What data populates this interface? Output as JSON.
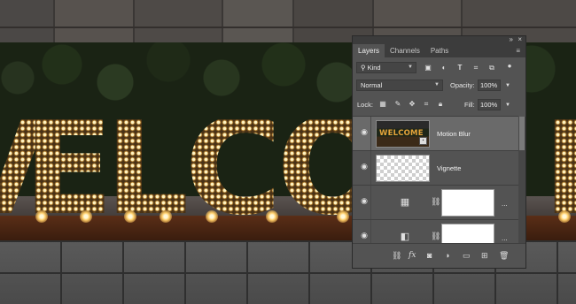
{
  "scene": {
    "letters": [
      "V",
      "E",
      "L",
      "C",
      "O",
      "E"
    ]
  },
  "panel": {
    "collapse_label": "»",
    "close_label": "×",
    "tabs": [
      {
        "label": "Layers",
        "active": true
      },
      {
        "label": "Channels",
        "active": false
      },
      {
        "label": "Paths",
        "active": false
      }
    ],
    "menu_label": "≡",
    "filter": {
      "value": "Kind",
      "icon": "search-icon"
    },
    "filter_icons": [
      "image-filter-icon",
      "adjustment-filter-icon",
      "type-filter-icon",
      "shape-filter-icon",
      "smart-object-filter-icon",
      "filter-toggle-icon"
    ],
    "blend_mode": "Normal",
    "opacity_label": "Opacity:",
    "opacity_value": "100%",
    "lock_label": "Lock:",
    "lock_icons": [
      "lock-transparent-icon",
      "lock-image-icon",
      "lock-position-icon",
      "lock-artboard-icon",
      "lock-all-icon"
    ],
    "fill_label": "Fill:",
    "fill_value": "100%",
    "layers": [
      {
        "name": "Motion Blur",
        "selected": true,
        "thumb_text": "WELCOME",
        "type": "smart-object"
      },
      {
        "name": "Vignette",
        "selected": false,
        "type": "empty"
      },
      {
        "name": "",
        "selected": false,
        "type": "pattern-adjustment",
        "more": "..."
      },
      {
        "name": "",
        "selected": false,
        "type": "gradient-adjustment",
        "more": "..."
      }
    ],
    "bottom_icons": [
      "link-layers-icon",
      "fx-icon",
      "add-mask-icon",
      "adjustment-layer-icon",
      "new-group-icon",
      "new-layer-icon",
      "trash-icon"
    ]
  }
}
